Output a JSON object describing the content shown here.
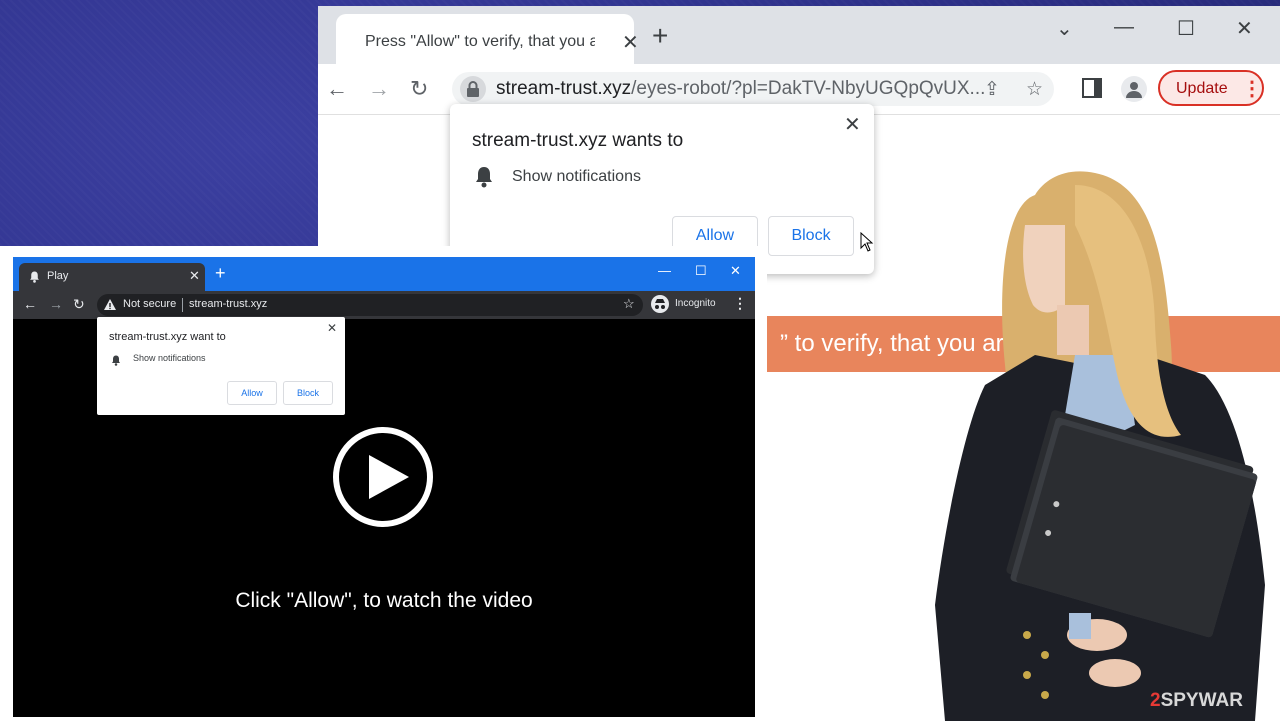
{
  "back_browser": {
    "tab_title": "Press \"Allow\" to verify, that you a",
    "url_domain": "stream-trust.xyz",
    "url_path": "/eyes-robot/?pl=DakTV-NbyUGQpQvUX...",
    "update_label": "Update",
    "permission": {
      "title": "stream-trust.xyz wants to",
      "text": "Show notifications",
      "allow": "Allow",
      "block": "Block"
    },
    "banner_text": "” to verify, that you ar"
  },
  "front_browser": {
    "tab_title": "Play",
    "not_secure": "Not secure",
    "url": "stream-trust.xyz",
    "incognito": "Incognito",
    "permission": {
      "title": "stream-trust.xyz want to",
      "text": "Show notifications",
      "allow": "Allow",
      "block": "Block"
    },
    "caption": "Click \"Allow\", to watch the video"
  },
  "watermark": {
    "num": "2",
    "text": "SPYWAR"
  },
  "icons": [
    "lock-icon",
    "bell-icon",
    "play-icon",
    "star-icon",
    "share-icon",
    "incognito-icon",
    "warning-icon",
    "cursor-icon"
  ],
  "colors": {
    "background": "#2e318a",
    "front_titlebar": "#1a73e8",
    "banner": "#e8855c",
    "update_border": "#d93025",
    "link_blue": "#1a73e8"
  }
}
